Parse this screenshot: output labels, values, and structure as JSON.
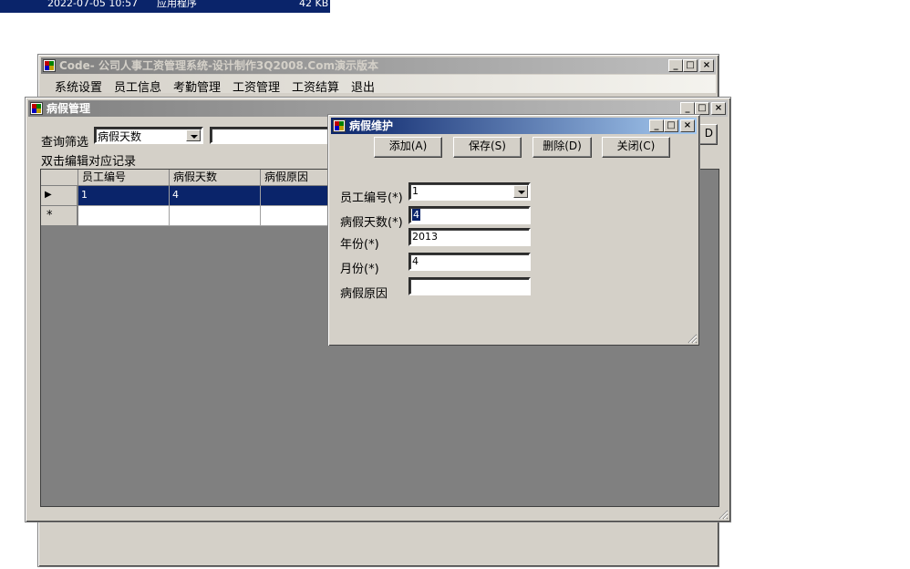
{
  "file_row": {
    "date": "2022-07-05 10:57",
    "type": "应用程序",
    "size": "42 KB"
  },
  "main_window": {
    "title": "Code- 公司人事工资管理系统-设计制作3Q2008.Com演示版本",
    "menu": [
      "系统设置",
      "员工信息",
      "考勤管理",
      "工资管理",
      "工资结算",
      "退出"
    ],
    "caption_buttons": {
      "minimize": "_",
      "maximize": "□",
      "close": "×"
    }
  },
  "sick_leave_window": {
    "title": "病假管理",
    "filter_label": "查询筛选",
    "filter_value": "病假天数",
    "filter_text": "",
    "hint": "双击编辑对应记录",
    "partial_button": "D",
    "grid": {
      "columns": [
        "员工编号",
        "病假天数",
        "病假原因"
      ],
      "rows": [
        {
          "marker": "▶",
          "cells": [
            "1",
            "4",
            ""
          ]
        },
        {
          "marker": "*",
          "cells": [
            "",
            "",
            ""
          ]
        }
      ]
    }
  },
  "dialog": {
    "title": "病假维护",
    "buttons": {
      "add": "添加(A)",
      "save": "保存(S)",
      "delete": "删除(D)",
      "close": "关闭(C)"
    },
    "fields": {
      "employee_id": {
        "label": "员工编号(*)",
        "value": "1"
      },
      "sick_days": {
        "label": "病假天数(*)",
        "value": "4"
      },
      "year": {
        "label": "年份(*)",
        "value": "2013"
      },
      "month": {
        "label": "月份(*)",
        "value": "4"
      },
      "reason": {
        "label": "病假原因",
        "value": ""
      }
    }
  },
  "colors": {
    "window_bg": "#d4d0c8",
    "active_title": "#0a246a",
    "selection": "#0a246a",
    "grid_bg": "#808080"
  }
}
